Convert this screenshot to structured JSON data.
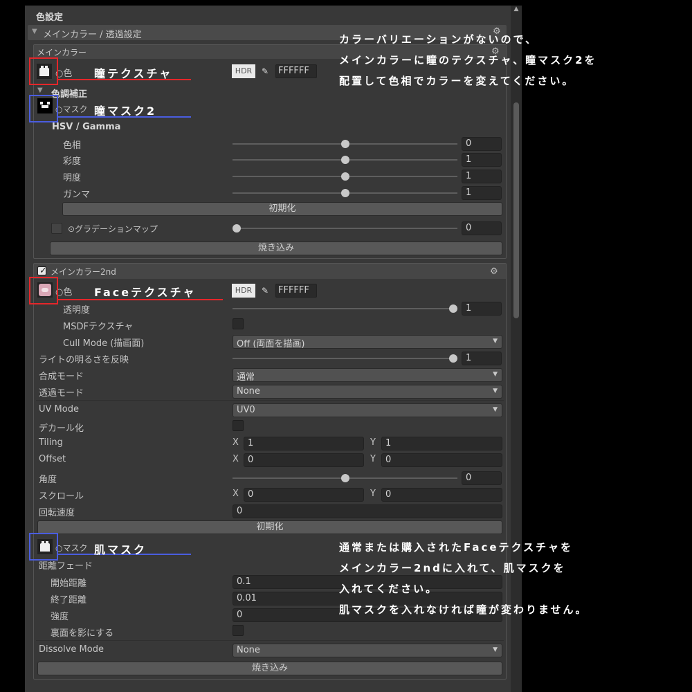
{
  "header": {
    "title": "色設定"
  },
  "main_fold": {
    "label": "メインカラー / 透過設定"
  },
  "main_color": {
    "header": "メインカラー",
    "color_label": "○色",
    "hdr": "HDR",
    "hex": "FFFFFF",
    "tone_fold": "色調補正",
    "mask_label": "○マスク",
    "hsv_title": "HSV / Gamma",
    "hue": {
      "label": "色相",
      "value": "0",
      "ratio": 0.5
    },
    "saturation": {
      "label": "彩度",
      "value": "1",
      "ratio": 0.5
    },
    "brightness": {
      "label": "明度",
      "value": "1",
      "ratio": 0.5
    },
    "gamma": {
      "label": "ガンマ",
      "value": "1",
      "ratio": 0.5
    },
    "reset": "初期化",
    "gradient_label": "⊙グラデーションマップ",
    "gradient": {
      "value": "0",
      "ratio": 0.0
    },
    "bake": "焼き込み"
  },
  "main_color_2nd": {
    "header": "メインカラー2nd",
    "color_label": "○色",
    "hdr": "HDR",
    "hex": "FFFFFF",
    "opacity": {
      "label": "透明度",
      "value": "1",
      "ratio": 1.0
    },
    "msdf_label": "MSDFテクスチャ",
    "cull_label": "Cull Mode (描画面)",
    "cull_value": "Off (両面を描画)",
    "light_label": "ライトの明るさを反映",
    "light": {
      "value": "1",
      "ratio": 1.0
    },
    "blend_label": "合成モード",
    "blend_value": "通常",
    "alpha_label": "透過モード",
    "alpha_value": "None",
    "uv_label": "UV Mode",
    "uv_value": "UV0",
    "decal_label": "デカール化",
    "tiling_label": "Tiling",
    "tiling_x": "1",
    "tiling_y": "1",
    "offset_label": "Offset",
    "offset_x": "0",
    "offset_y": "0",
    "angle_label": "角度",
    "angle": {
      "value": "0",
      "ratio": 0.5
    },
    "scroll_label": "スクロール",
    "scroll_x": "0",
    "scroll_y": "0",
    "rot_label": "回転速度",
    "rot_value": "0",
    "reset": "初期化",
    "mask_label": "○マスク",
    "distance_fade_label": "距離フェード",
    "start_label": "開始距離",
    "start_value": "0.1",
    "end_label": "終了距離",
    "end_value": "0.01",
    "strength_label": "強度",
    "strength_value": "0",
    "backface_label": "裏面を影にする",
    "dissolve_label": "Dissolve Mode",
    "dissolve_value": "None",
    "bake": "焼き込み"
  },
  "axis": {
    "x": "X",
    "y": "Y"
  },
  "annotations": {
    "eye_texture": "瞳テクスチャ",
    "eye_mask": "瞳マスク2",
    "face_texture": "Faceテクスチャ",
    "skin_mask": "肌マスク",
    "note_top": [
      "カラーバリエーションがないので、",
      "メインカラーに瞳のテクスチャ、瞳マスク2を",
      "配置して色相でカラーを変えてください。"
    ],
    "note_bottom": [
      "通常または購入されたFaceテクスチャを",
      "メインカラー2ndに入れて、肌マスクを",
      "入れてください。",
      "肌マスクを入れなければ瞳が変わりません。"
    ]
  },
  "colors": {
    "red_marker": "#e5262a",
    "blue_marker": "#4a5de0",
    "panel": "#383838"
  }
}
